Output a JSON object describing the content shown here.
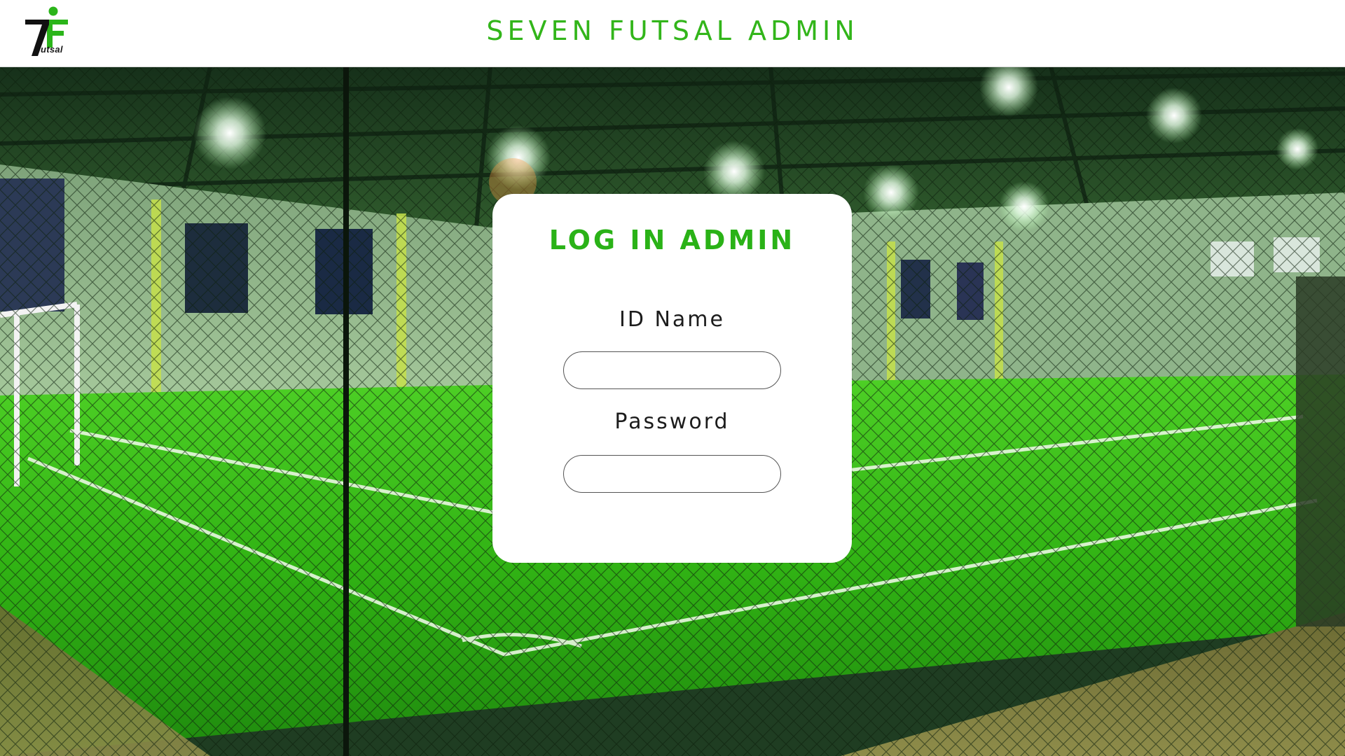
{
  "header": {
    "title": "SEVEN FUTSAL ADMIN",
    "logo": {
      "mark": "7F",
      "subtitle": "utsal",
      "colors": {
        "seven": "#111111",
        "f_letter": "#2bb51a",
        "dot": "#2bb51a"
      }
    }
  },
  "login": {
    "title": "LOG IN ADMIN",
    "id_label": "ID Name",
    "id_value": "",
    "id_placeholder": "",
    "password_label": "Password",
    "password_value": "",
    "password_placeholder": ""
  },
  "colors": {
    "accent": "#2ab217",
    "header_bg": "#ffffff",
    "card_bg": "#ffffff",
    "turf": "#3fbf1c",
    "label_text": "#1c1c1c"
  },
  "background": {
    "icon": "futsal-court-photo"
  }
}
